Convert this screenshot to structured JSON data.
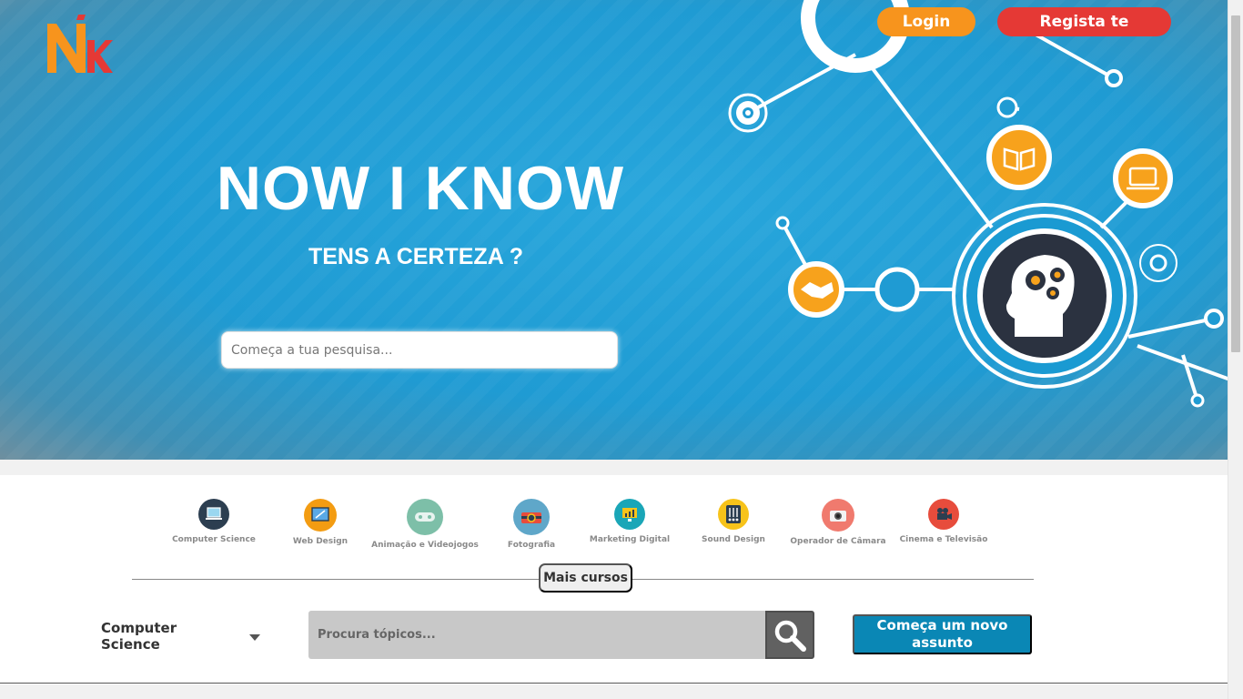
{
  "header": {
    "login_label": "Login",
    "register_label": "Regista te"
  },
  "hero": {
    "title": "NOW I KNOW",
    "subtitle": "TENS A CERTEZA ?",
    "search_placeholder": "Começa a tua pesquisa..."
  },
  "categories": [
    {
      "label": "Computer Science",
      "icon": "laptop-icon",
      "color": "#2c3e50"
    },
    {
      "label": "Web Design",
      "icon": "web-design-icon",
      "color": "#f39c12"
    },
    {
      "label": "Animação e Videojogos",
      "icon": "gamepad-icon",
      "color": "#7dbfa8"
    },
    {
      "label": "Fotografia",
      "icon": "camera-icon",
      "color": "#5fa7c9"
    },
    {
      "label": "Marketing Digital",
      "icon": "chart-monitor-icon",
      "color": "#1aa6b7"
    },
    {
      "label": "Sound Design",
      "icon": "mixer-icon",
      "color": "#f7c31a"
    },
    {
      "label": "Operador de Câmara",
      "icon": "photo-camera-icon",
      "color": "#f07a6e"
    },
    {
      "label": "Cinema e Televisão",
      "icon": "film-camera-icon",
      "color": "#e74c3c"
    }
  ],
  "more_courses_label": "Mais cursos",
  "filter": {
    "selected_category": "Computer Science",
    "topic_search_placeholder": "Procura tópicos...",
    "new_topic_label": "Começa um novo assunto"
  },
  "colors": {
    "accent_orange": "#f7941d",
    "accent_red": "#e53935",
    "hero_blue": "#1f9bd3",
    "primary_blue": "#0a87b5"
  }
}
